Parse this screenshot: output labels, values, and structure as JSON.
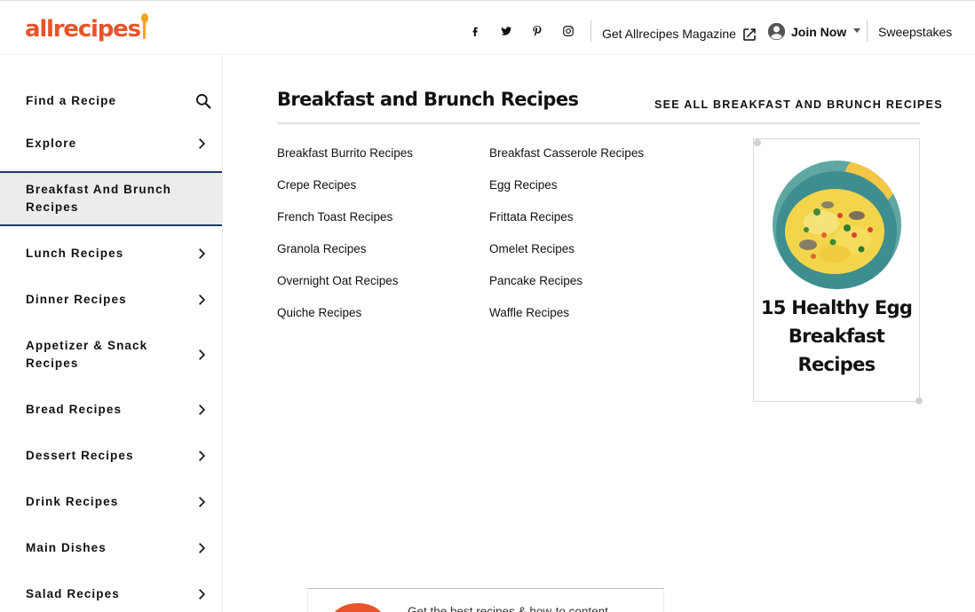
{
  "header": {
    "logo": "allrecipes",
    "social": [
      "facebook-icon",
      "twitter-icon",
      "pinterest-icon",
      "instagram-icon"
    ],
    "magazine_label": "Get Allrecipes Magazine",
    "join_label": "Join Now",
    "sweepstakes_label": "Sweepstakes"
  },
  "sidebar": {
    "items": [
      {
        "label": "Find a Recipe",
        "icon": "search-icon"
      },
      {
        "label": "Explore",
        "icon": "chevron-right-icon"
      },
      {
        "label": "Breakfast And Brunch Recipes",
        "icon": "",
        "active": true
      },
      {
        "label": "Lunch Recipes",
        "icon": "chevron-right-icon"
      },
      {
        "label": "Dinner Recipes",
        "icon": "chevron-right-icon"
      },
      {
        "label": "Appetizer & Snack Recipes",
        "icon": "chevron-right-icon"
      },
      {
        "label": "Bread Recipes",
        "icon": "chevron-right-icon"
      },
      {
        "label": "Dessert Recipes",
        "icon": "chevron-right-icon"
      },
      {
        "label": "Drink Recipes",
        "icon": "chevron-right-icon"
      },
      {
        "label": "Main Dishes",
        "icon": "chevron-right-icon"
      },
      {
        "label": "Salad Recipes",
        "icon": "chevron-right-icon"
      }
    ]
  },
  "main": {
    "title": "Breakfast and Brunch Recipes",
    "see_all": "SEE ALL BREAKFAST AND BRUNCH RECIPES",
    "links_col1": [
      "Breakfast Burrito Recipes",
      "Crepe Recipes",
      "French Toast Recipes",
      "Granola Recipes",
      "Overnight Oat Recipes",
      "Quiche Recipes"
    ],
    "links_col2": [
      "Breakfast Casserole Recipes",
      "Egg Recipes",
      "Frittata Recipes",
      "Omelet Recipes",
      "Pancake Recipes",
      "Waffle Recipes"
    ]
  },
  "promo": {
    "title": "15 Healthy Egg Breakfast Recipes"
  },
  "newsletter": {
    "text": "Get the best recipes & how-to content"
  },
  "colors": {
    "brand": "#e9532a",
    "spoon": "#f7a41d",
    "active_border": "#1a3a6b",
    "active_bg": "#ececec"
  }
}
